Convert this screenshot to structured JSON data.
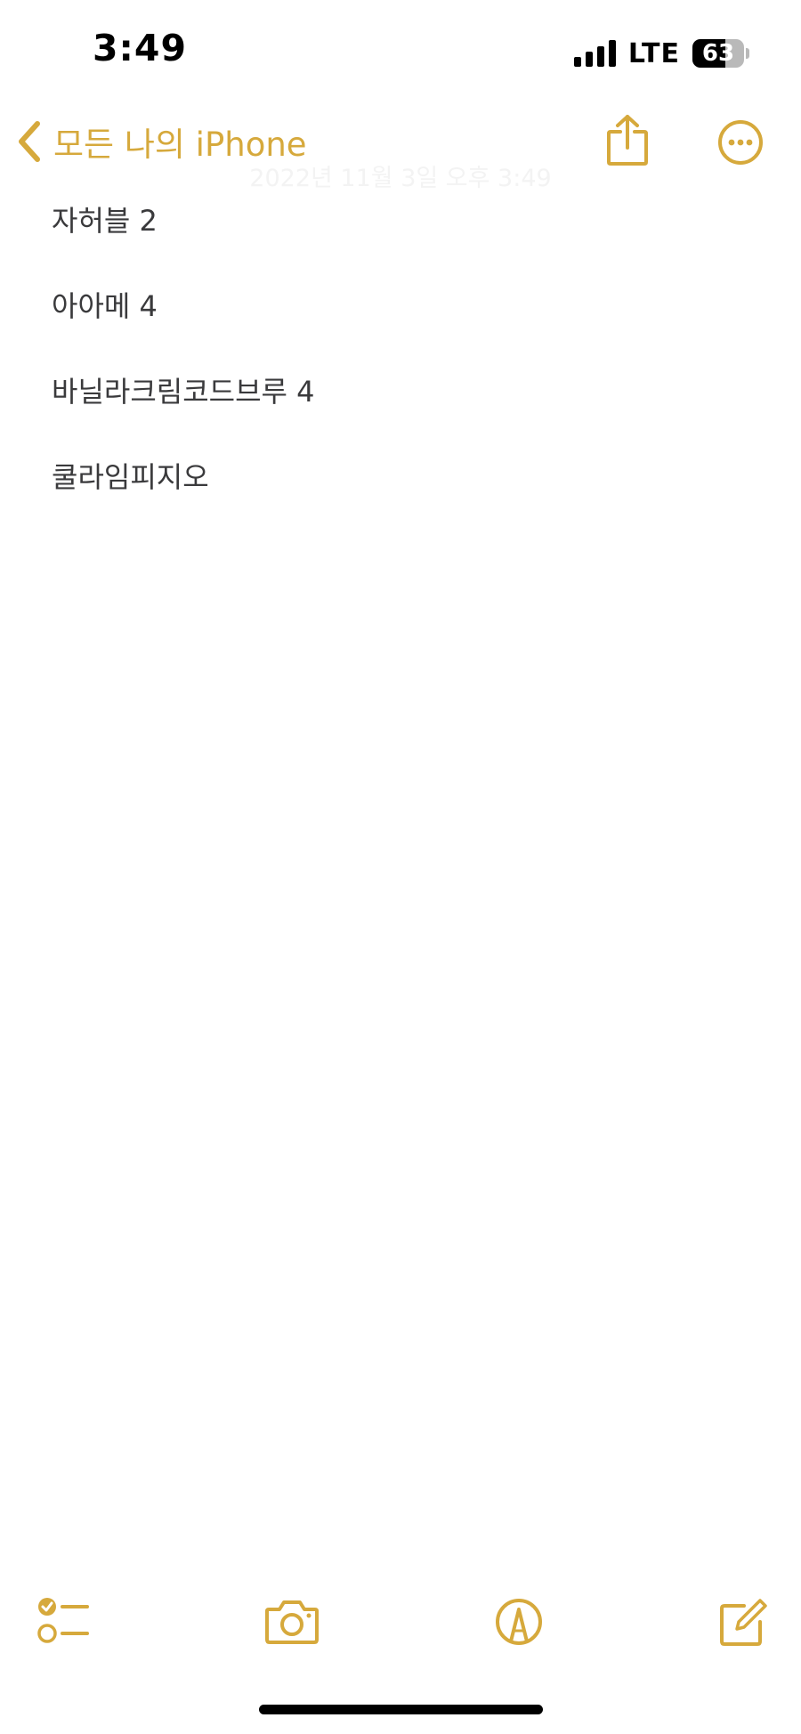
{
  "status_bar": {
    "time": "3:49",
    "network": "LTE",
    "battery": "63",
    "battery_level": 0.63
  },
  "nav": {
    "back_label": "모든 나의 iPhone",
    "note_date": "2022년 11월 3일 오후 3:49"
  },
  "note": {
    "lines": [
      "자허블 2",
      "아아메 4",
      "바닐라크림코드브루 4",
      "쿨라임피지오"
    ]
  },
  "colors": {
    "accent": "#d6a93c",
    "text": "#3a3a3c",
    "date_text": "#f3f3f3"
  },
  "icons": {
    "back": "chevron-left-icon",
    "share": "share-icon",
    "more": "ellipsis-circle-icon",
    "checklist": "checklist-icon",
    "camera": "camera-icon",
    "markup": "markup-pen-icon",
    "compose": "compose-icon"
  }
}
